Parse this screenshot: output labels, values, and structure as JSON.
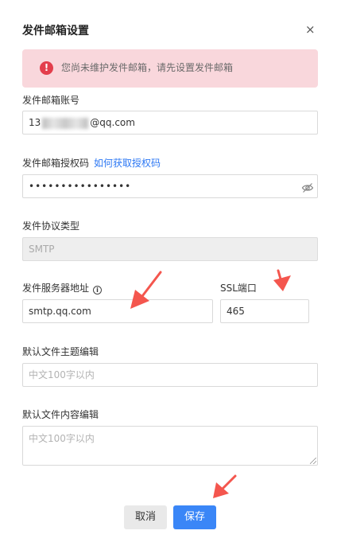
{
  "dialog": {
    "title": "发件邮箱设置",
    "close_glyph": "×"
  },
  "alert": {
    "icon": "!",
    "text": "您尚未维护发件邮箱，请先设置发件邮箱"
  },
  "form": {
    "email": {
      "label": "发件邮箱账号",
      "value_prefix": "13",
      "value_suffix": "@qq.com"
    },
    "auth_code": {
      "label": "发件邮箱授权码",
      "help_link": "如何获取授权码",
      "value": "••••••••••••••••"
    },
    "protocol": {
      "label": "发件协议类型",
      "value": "SMTP"
    },
    "server": {
      "label": "发件服务器地址",
      "info_glyph": "i",
      "value": "smtp.qq.com"
    },
    "ssl_port": {
      "label": "SSL端口",
      "value": "465"
    },
    "subject": {
      "label": "默认文件主题编辑",
      "placeholder": "中文100字以内"
    },
    "content": {
      "label": "默认文件内容编辑",
      "placeholder": "中文100字以内"
    }
  },
  "buttons": {
    "cancel": "取消",
    "save": "保存"
  },
  "colors": {
    "accent": "#3a86f7",
    "link": "#2d78f4",
    "alert_bg": "#f9d7dc",
    "alert_icon": "#e33e4c",
    "annotation_arrow": "#f4564e"
  }
}
